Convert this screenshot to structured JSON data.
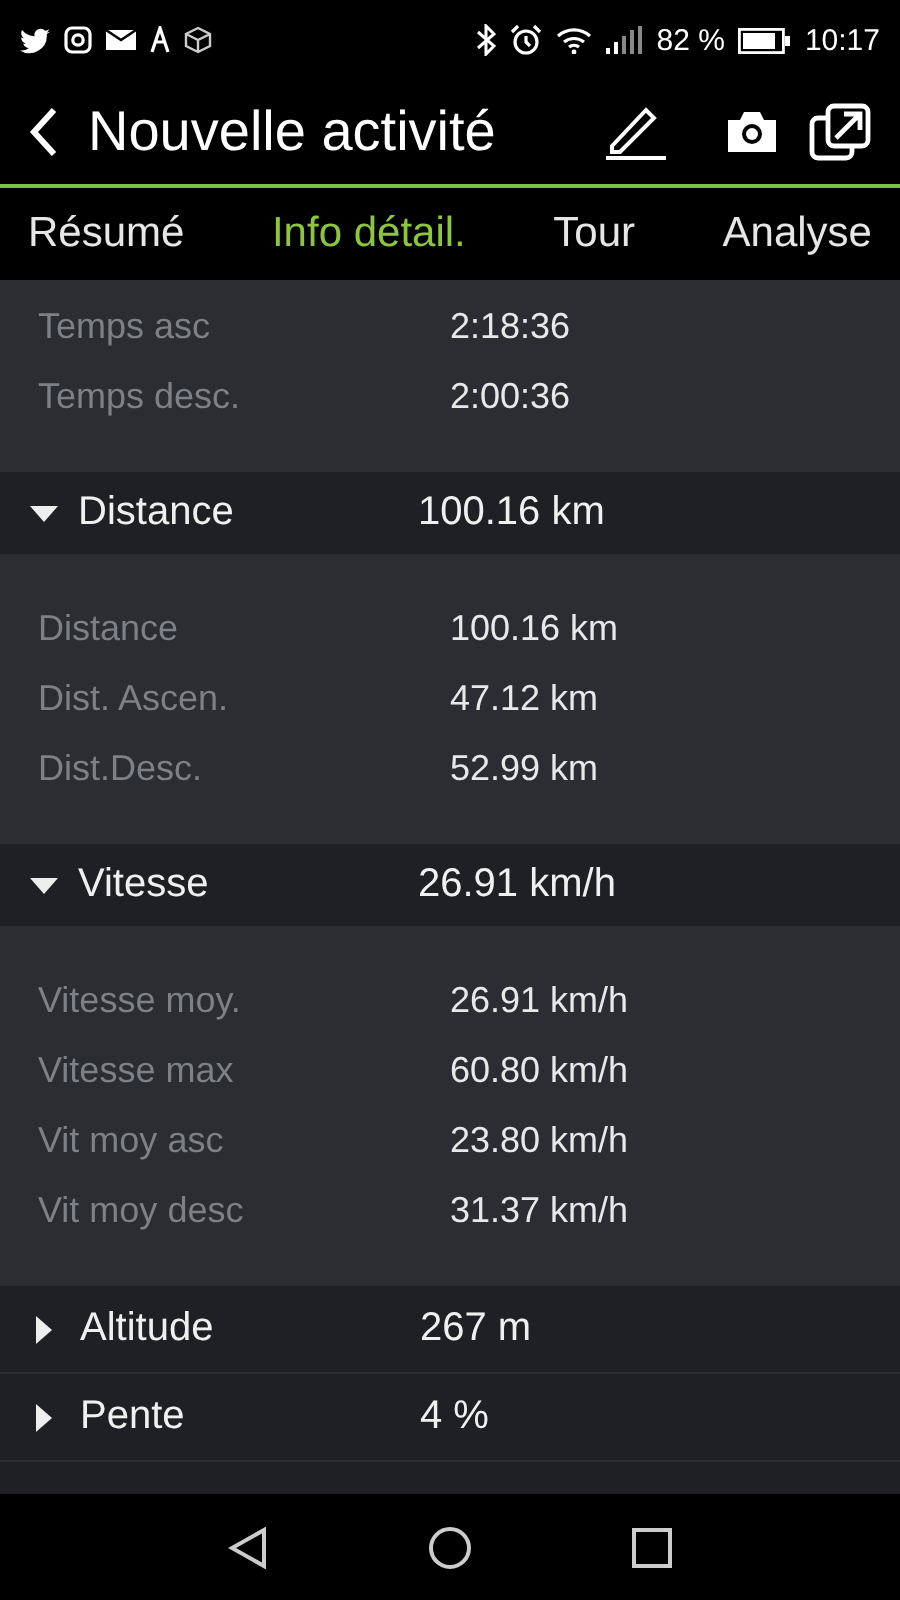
{
  "status_bar": {
    "battery": "82 %",
    "time": "10:17"
  },
  "header": {
    "title": "Nouvelle activité"
  },
  "tabs": [
    {
      "label": "Résumé",
      "selected": false
    },
    {
      "label": "Info détail.",
      "selected": true
    },
    {
      "label": "Tour",
      "selected": false
    },
    {
      "label": "Analyse",
      "selected": false
    }
  ],
  "items": [
    {
      "kind": "details",
      "rows": [
        {
          "label": "Temps asc",
          "value": "2:18:36"
        },
        {
          "label": "Temps desc.",
          "value": "2:00:36"
        }
      ]
    },
    {
      "kind": "section",
      "label": "Distance",
      "value": "100.16 km",
      "expanded": true
    },
    {
      "kind": "details",
      "rows": [
        {
          "label": "Distance",
          "value": "100.16 km"
        },
        {
          "label": "Dist. Ascen.",
          "value": "47.12 km"
        },
        {
          "label": "Dist.Desc.",
          "value": "52.99 km"
        }
      ]
    },
    {
      "kind": "section",
      "label": "Vitesse",
      "value": "26.91 km/h",
      "expanded": true
    },
    {
      "kind": "details",
      "rows": [
        {
          "label": "Vitesse moy.",
          "value": "26.91 km/h"
        },
        {
          "label": "Vitesse max",
          "value": "60.80 km/h"
        },
        {
          "label": "Vit moy asc",
          "value": "23.80 km/h"
        },
        {
          "label": "Vit moy desc",
          "value": "31.37 km/h"
        }
      ]
    },
    {
      "kind": "section",
      "label": "Altitude",
      "value": "267 m",
      "expanded": false
    },
    {
      "kind": "section",
      "label": "Pente",
      "value": "4 %",
      "expanded": false
    }
  ]
}
